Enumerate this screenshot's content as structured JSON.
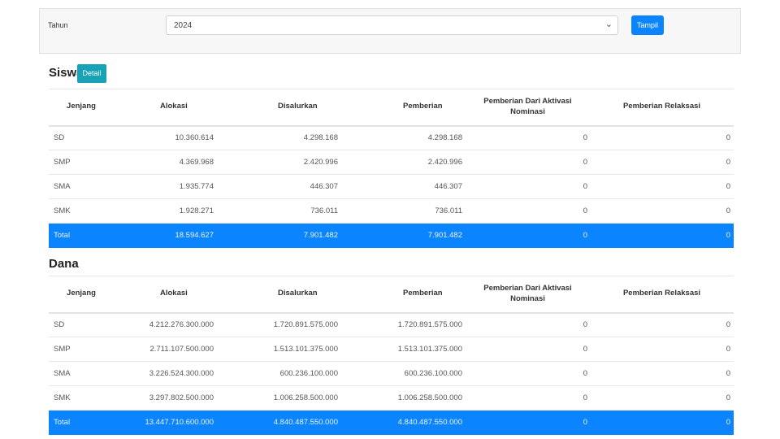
{
  "filter": {
    "label": "Tahun",
    "selected_year": "2024",
    "button_label": "Tampil"
  },
  "siswa": {
    "title": "Siswa",
    "detail_label": "Detail",
    "headers": [
      "Jenjang",
      "Alokasi",
      "Disalurkan",
      "Pemberian",
      "Pemberian Dari Aktivasi Nominasi",
      "Pemberian Relaksasi"
    ],
    "rows": [
      [
        "SD",
        "10.360.614",
        "4.298.168",
        "4.298.168",
        "0",
        "0"
      ],
      [
        "SMP",
        "4.369.968",
        "2.420.996",
        "2.420.996",
        "0",
        "0"
      ],
      [
        "SMA",
        "1.935.774",
        "446.307",
        "446.307",
        "0",
        "0"
      ],
      [
        "SMK",
        "1.928.271",
        "736.011",
        "736.011",
        "0",
        "0"
      ]
    ],
    "total": [
      "Total",
      "18.594.627",
      "7.901.482",
      "7.901.482",
      "0",
      "0"
    ]
  },
  "dana": {
    "title": "Dana",
    "headers": [
      "Jenjang",
      "Alokasi",
      "Disalurkan",
      "Pemberian",
      "Pemberian Dari Aktivasi Nominasi",
      "Pemberian Relaksasi"
    ],
    "rows": [
      [
        "SD",
        "4.212.276.300.000",
        "1.720.891.575.000",
        "1.720.891.575.000",
        "0",
        "0"
      ],
      [
        "SMP",
        "2.711.107.500.000",
        "1.513.101.375.000",
        "1.513.101.375.000",
        "0",
        "0"
      ],
      [
        "SMA",
        "3.226.524.300.000",
        "600.236.100.000",
        "600.236.100.000",
        "0",
        "0"
      ],
      [
        "SMK",
        "3.297.802.500.000",
        "1.006.258.500.000",
        "1.006.258.500.000",
        "0",
        "0"
      ]
    ],
    "total": [
      "Total",
      "13.447.710.600.000",
      "4.840.487.550.000",
      "4.840.487.550.000",
      "0",
      "0"
    ]
  }
}
